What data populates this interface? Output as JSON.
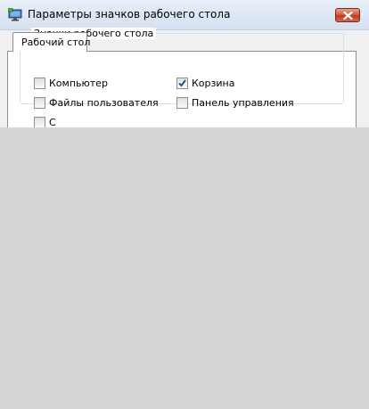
{
  "window": {
    "title": "Параметры значков рабочего стола",
    "icons": {
      "app": "desktop-settings-icon",
      "close": "close-icon"
    },
    "colors": {
      "close_button": "#c8452c",
      "client_bg": "#f0f0f0",
      "occluded_area": "#d6d6d8"
    }
  },
  "tabs": [
    {
      "label": "Рабочий стол",
      "selected": true
    }
  ],
  "desktop_icons": {
    "group_title": "Значки рабочего стола",
    "items": [
      {
        "label": "Компьютер",
        "checked": false
      },
      {
        "label": "Корзина",
        "checked": true
      },
      {
        "label": "Файлы пользователя",
        "checked": false
      },
      {
        "label": "Панель управления",
        "checked": false
      },
      {
        "label": "С",
        "checked": false
      }
    ]
  }
}
